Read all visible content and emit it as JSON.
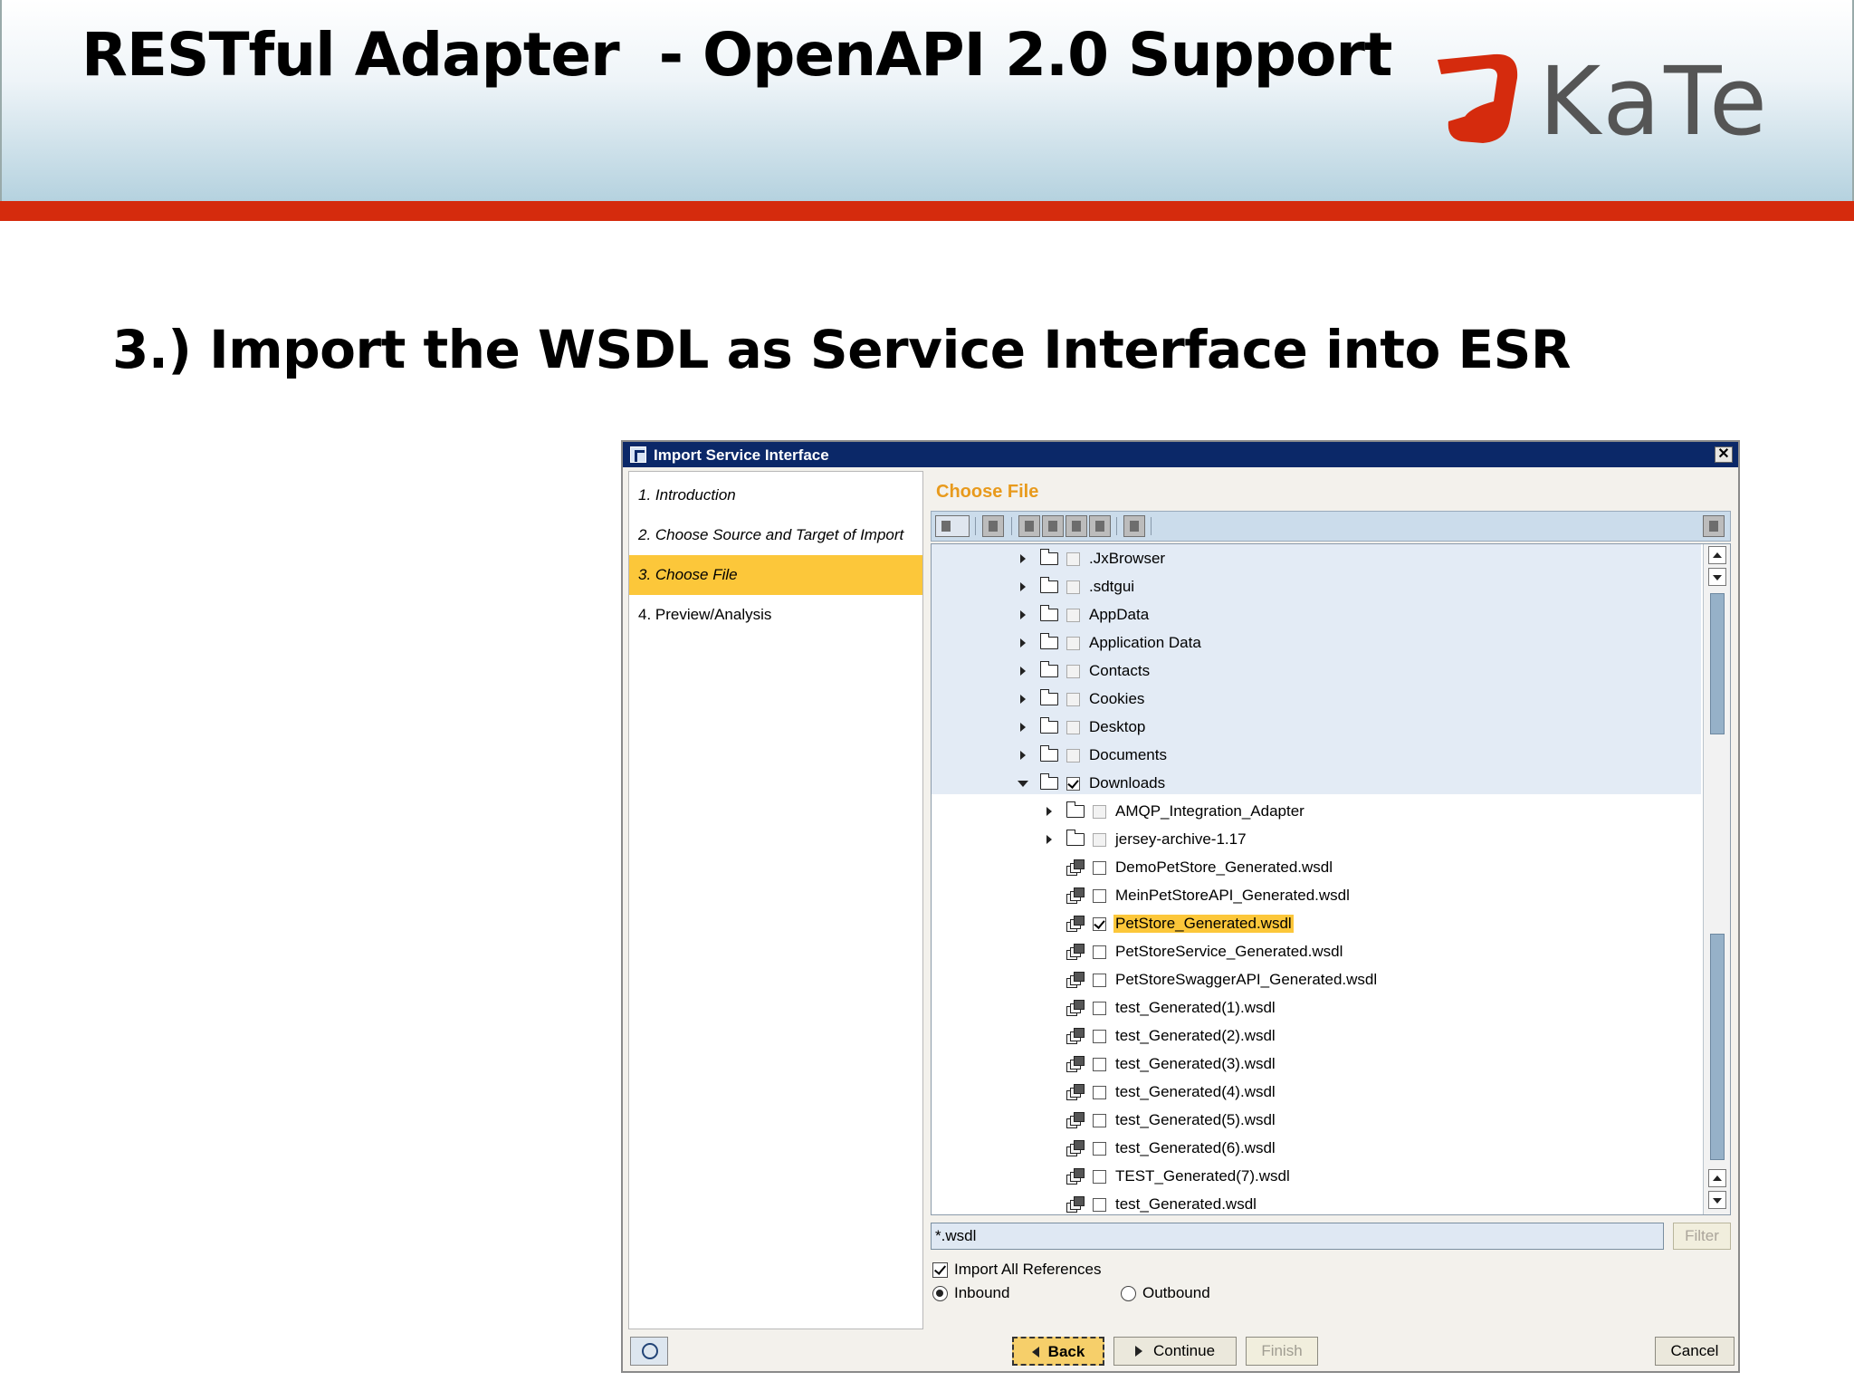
{
  "slide": {
    "title": "RESTful Adapter  - OpenAPI 2.0 Support",
    "logo_text": "KaTe",
    "step_heading": "3.) Import the WSDL as Service Interface into ESR"
  },
  "dialog": {
    "title": "Import Service Interface",
    "close_label": "✕",
    "steps": [
      {
        "label": "1. Introduction",
        "state": "done"
      },
      {
        "label": "2. Choose Source and Target of Import",
        "state": "done"
      },
      {
        "label": "3. Choose File",
        "state": "active"
      },
      {
        "label": "4. Preview/Analysis",
        "state": "pending"
      }
    ],
    "section_title": "Choose File",
    "tree": [
      {
        "label": ".JxBrowser",
        "type": "folder",
        "level": 0,
        "checked": false
      },
      {
        "label": ".sdtgui",
        "type": "folder",
        "level": 0,
        "checked": false
      },
      {
        "label": "AppData",
        "type": "folder",
        "level": 0,
        "checked": false
      },
      {
        "label": "Application Data",
        "type": "folder",
        "level": 0,
        "checked": false
      },
      {
        "label": "Contacts",
        "type": "folder",
        "level": 0,
        "checked": false
      },
      {
        "label": "Cookies",
        "type": "folder",
        "level": 0,
        "checked": false
      },
      {
        "label": "Desktop",
        "type": "folder",
        "level": 0,
        "checked": false
      },
      {
        "label": "Documents",
        "type": "folder",
        "level": 0,
        "checked": false
      },
      {
        "label": "Downloads",
        "type": "folder-open",
        "level": 0,
        "checked": true
      },
      {
        "label": "AMQP_Integration_Adapter",
        "type": "folder",
        "level": 1,
        "checked": false
      },
      {
        "label": "jersey-archive-1.17",
        "type": "folder",
        "level": 1,
        "checked": false
      },
      {
        "label": "DemoPetStore_Generated.wsdl",
        "type": "file",
        "level": 1,
        "checked": false
      },
      {
        "label": "MeinPetStoreAPI_Generated.wsdl",
        "type": "file",
        "level": 1,
        "checked": false
      },
      {
        "label": "PetStore_Generated.wsdl",
        "type": "file",
        "level": 1,
        "checked": true,
        "selected": true
      },
      {
        "label": "PetStoreService_Generated.wsdl",
        "type": "file",
        "level": 1,
        "checked": false
      },
      {
        "label": "PetStoreSwaggerAPI_Generated.wsdl",
        "type": "file",
        "level": 1,
        "checked": false
      },
      {
        "label": "test_Generated(1).wsdl",
        "type": "file",
        "level": 1,
        "checked": false
      },
      {
        "label": "test_Generated(2).wsdl",
        "type": "file",
        "level": 1,
        "checked": false
      },
      {
        "label": "test_Generated(3).wsdl",
        "type": "file",
        "level": 1,
        "checked": false
      },
      {
        "label": "test_Generated(4).wsdl",
        "type": "file",
        "level": 1,
        "checked": false
      },
      {
        "label": "test_Generated(5).wsdl",
        "type": "file",
        "level": 1,
        "checked": false
      },
      {
        "label": "test_Generated(6).wsdl",
        "type": "file",
        "level": 1,
        "checked": false
      },
      {
        "label": "TEST_Generated(7).wsdl",
        "type": "file",
        "level": 1,
        "checked": false
      },
      {
        "label": "test_Generated.wsdl",
        "type": "file",
        "level": 1,
        "checked": false
      }
    ],
    "filter_value": "*.wsdl",
    "filter_button": "Filter",
    "import_all_references": {
      "label": "Import All References",
      "checked": true
    },
    "direction": {
      "inbound_label": "Inbound",
      "outbound_label": "Outbound",
      "selected": "Inbound"
    },
    "buttons": {
      "back": "Back",
      "continue": "Continue",
      "finish": "Finish",
      "cancel": "Cancel"
    }
  },
  "colors": {
    "accent_red": "#d52b0d",
    "selection_yellow": "#fcc73a",
    "section_title_orange": "#e89a1c",
    "titlebar_navy": "#0b2868"
  }
}
